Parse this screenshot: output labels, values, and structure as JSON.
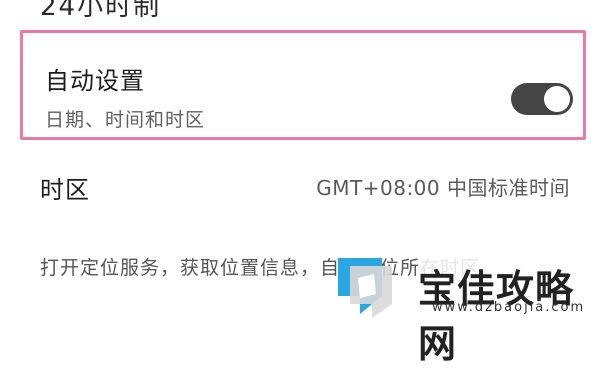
{
  "top_partial": "24小时制",
  "auto_setting": {
    "title": "自动设置",
    "subtitle": "日期、时间和时区",
    "toggle_on": true,
    "highlight_color": "#e879a8"
  },
  "timezone": {
    "label": "时区",
    "value": "GMT+08:00 中国标准时间"
  },
  "description": "打开定位服务，获取位置信息，自动定位所在时区",
  "watermark": {
    "brand": "宝佳攻略网",
    "domain": "www.dzbaojia.com",
    "accent": "#2aa7e0"
  }
}
